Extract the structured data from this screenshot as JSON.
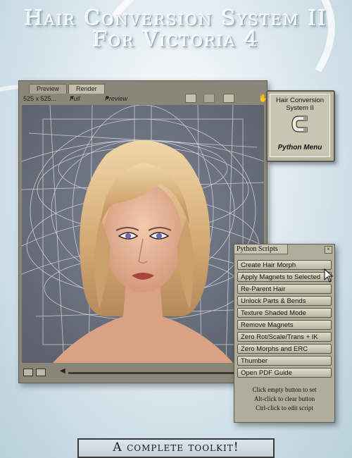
{
  "title": {
    "line1": "Hair Conversion System II",
    "line2": "For Victoria 4"
  },
  "window": {
    "tabs": [
      "Preview",
      "Render"
    ],
    "active_tab": "Render",
    "size_label": "525 x 525...",
    "quality_label": "Full",
    "mode_label": "Preview"
  },
  "badge": {
    "line1": "Hair Conversion",
    "line2": "System II",
    "menu_label": "Python Menu"
  },
  "python_panel": {
    "title": "Python Scripts",
    "buttons": [
      "Create Hair Morph",
      "Apply Magnets to Selected",
      "Re-Parent Hair",
      "Unlock Parts & Bends",
      "Texture Shaded Mode",
      "Remove Magnets",
      "Zero Rot/Scale/Trans + IK",
      "Zero Morphs and ERC",
      "Thumber",
      "Open PDF Guide"
    ],
    "help": [
      "Click empty button to set",
      "Alt-click to clear button",
      "Ctrl-click to edit script"
    ]
  },
  "banner": "A complete toolkit!",
  "colors": {
    "panel": "#b1ad9c",
    "window": "#8b8778",
    "viewport": "#6e7380",
    "skin": "#e6b59a",
    "hair": "#d8b583"
  }
}
